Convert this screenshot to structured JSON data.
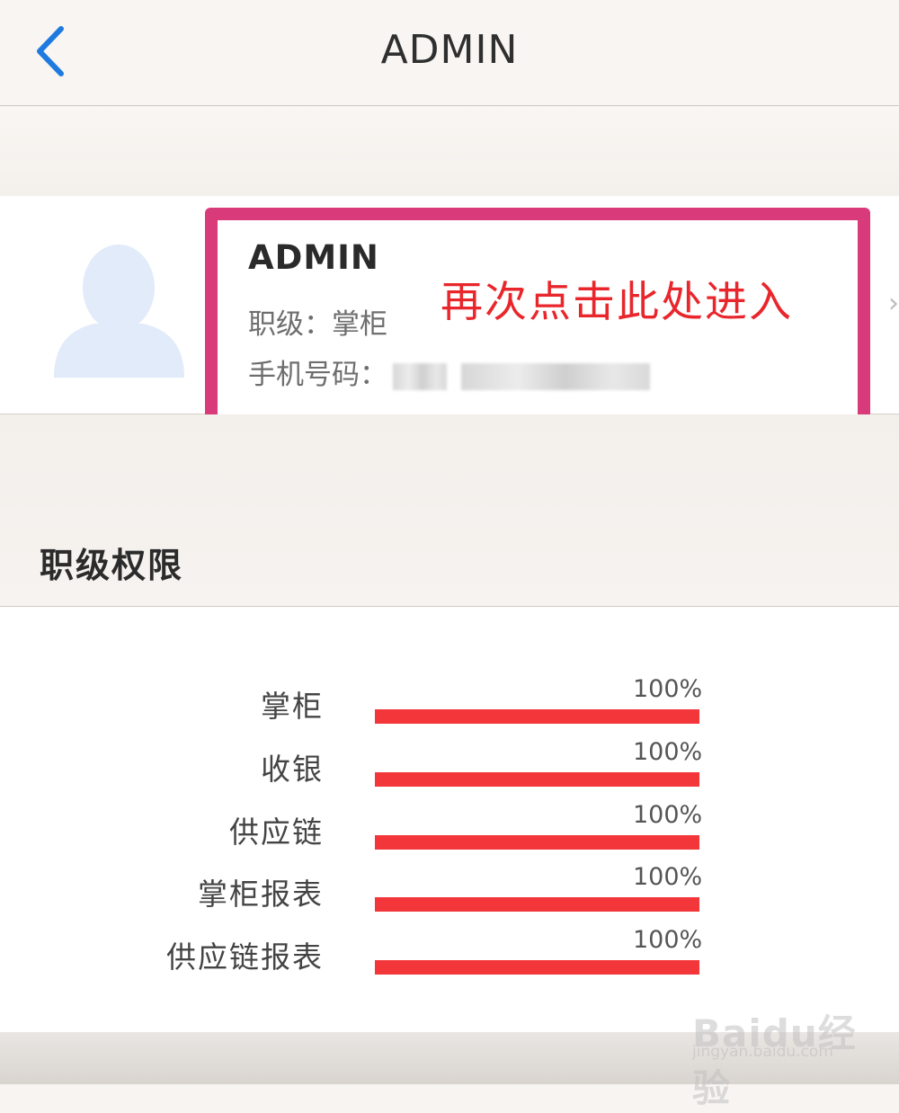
{
  "header": {
    "title": "ADMIN",
    "back_icon": "chevron-left-icon",
    "accent": "#1f7ae0"
  },
  "profile": {
    "name": "ADMIN",
    "level_label": "职级：",
    "level_value": "掌柜",
    "phone_label": "手机号码：",
    "annotation": "再次点击此处进入",
    "annotation_color": "#e8262b",
    "highlight_color": "#d93a7a"
  },
  "section": {
    "title": "职级权限"
  },
  "permissions": [
    {
      "label": "掌柜",
      "percent_text": "100%",
      "value": 100
    },
    {
      "label": "收银",
      "percent_text": "100%",
      "value": 100
    },
    {
      "label": "供应链",
      "percent_text": "100%",
      "value": 100
    },
    {
      "label": "掌柜报表",
      "percent_text": "100%",
      "value": 100
    },
    {
      "label": "供应链报表",
      "percent_text": "100%",
      "value": 100
    }
  ],
  "bar_color": "#f2363a",
  "watermark": {
    "brand": "Baidu经验",
    "url": "jingyan.baidu.com"
  }
}
